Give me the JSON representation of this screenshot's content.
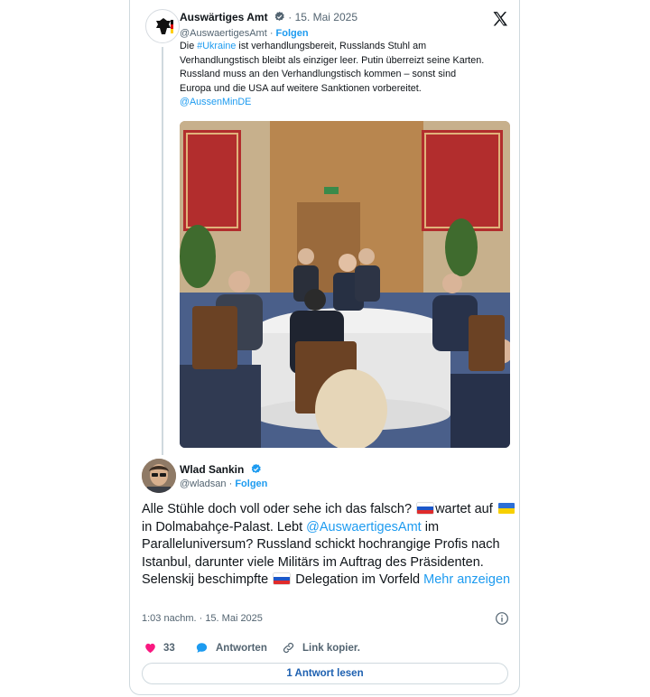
{
  "quoted": {
    "name": "Auswärtiges Amt",
    "sep": "·",
    "date": "15. Mai 2025",
    "handle": "@AuswaertigesAmt",
    "follow": "Folgen",
    "text_line1_pre": "Die ",
    "hashtag": "#Ukraine",
    "text_line1_post": " ist verhandlungsbereit, Russlands Stuhl am",
    "text_line2": "Verhandlungstisch bleibt als einziger leer. Putin überreizt seine Karten.",
    "text_line3": "Russland muss an den Verhandlungstisch kommen – sonst sind",
    "text_line4": "Europa und die USA auf weitere Sanktionen vorbereitet.",
    "mention": "@AussenMinDE"
  },
  "reply": {
    "name": "Wlad Sankin",
    "handle": "@wladsan",
    "sep": "·",
    "follow": "Folgen",
    "t1": "Alle Stühle doch voll oder sehe ich das falsch? ",
    "t2": "wartet auf ",
    "t3": " in Dolmabahçe-Palast. Lebt ",
    "mention": "@AuswaertigesAmt",
    "t4": " im Paralleluniversum? Russland schickt hochrangige Profis nach Istanbul, darunter viele Militärs im Auftrag des Präsidenten. Selenskij beschimpfte ",
    "t5": " Delegation im Vorfeld ",
    "more": "Mehr anzeigen",
    "timestamp": "1:03 nachm. · 15. Mai 2025",
    "likes": "33",
    "reply_label": "Antworten",
    "copy_label": "Link kopier.",
    "read_replies": "1 Antwort lesen"
  },
  "colors": {
    "accent": "#1d9bf0",
    "like": "#f91880",
    "verified": "#1d9bf0"
  },
  "icons": [
    "eagle-logo-icon",
    "verified-icon",
    "x-logo-icon",
    "info-icon",
    "heart-icon",
    "reply-bubble-icon",
    "link-icon",
    "flag-russia-icon",
    "flag-ukraine-icon"
  ]
}
